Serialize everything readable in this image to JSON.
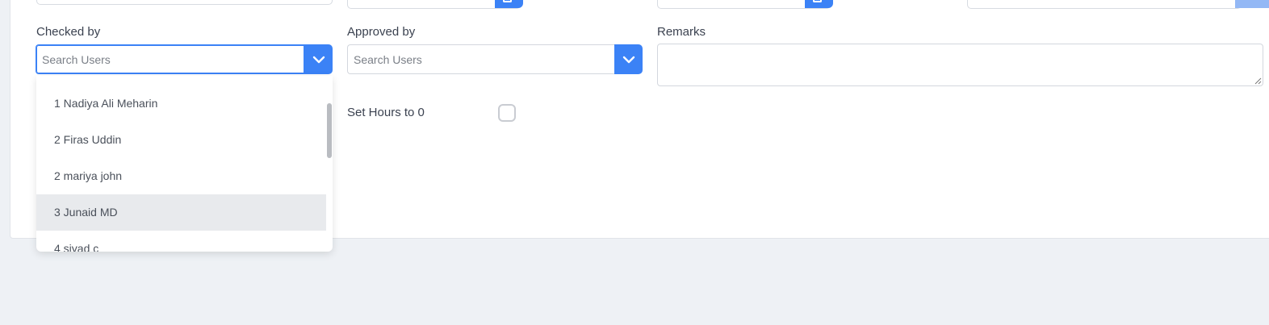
{
  "fields": {
    "checked_by": {
      "label": "Checked by",
      "placeholder": "Search Users"
    },
    "approved_by": {
      "label": "Approved by",
      "placeholder": "Search Users"
    },
    "remarks": {
      "label": "Remarks",
      "value": ""
    }
  },
  "set_hours": {
    "label": "Set Hours to 0",
    "checked": false
  },
  "top_partial": {
    "date_1_text": "···",
    "date_2_text": "···"
  },
  "dropdown": {
    "items": [
      {
        "label": "1 Nadiya Ali Meharin"
      },
      {
        "label": "2 Firas Uddin"
      },
      {
        "label": "2 mariya john"
      },
      {
        "label": "3 Junaid MD"
      },
      {
        "label": "4 siyad c"
      }
    ],
    "highlighted_index": 3
  },
  "colors": {
    "accent": "#3b82f6",
    "page_background": "#eef1f5",
    "hover_row": "#e8eaed"
  },
  "icons": {
    "select_toggle": "chevron-down-icon",
    "date_picker": "calendar-icon"
  }
}
